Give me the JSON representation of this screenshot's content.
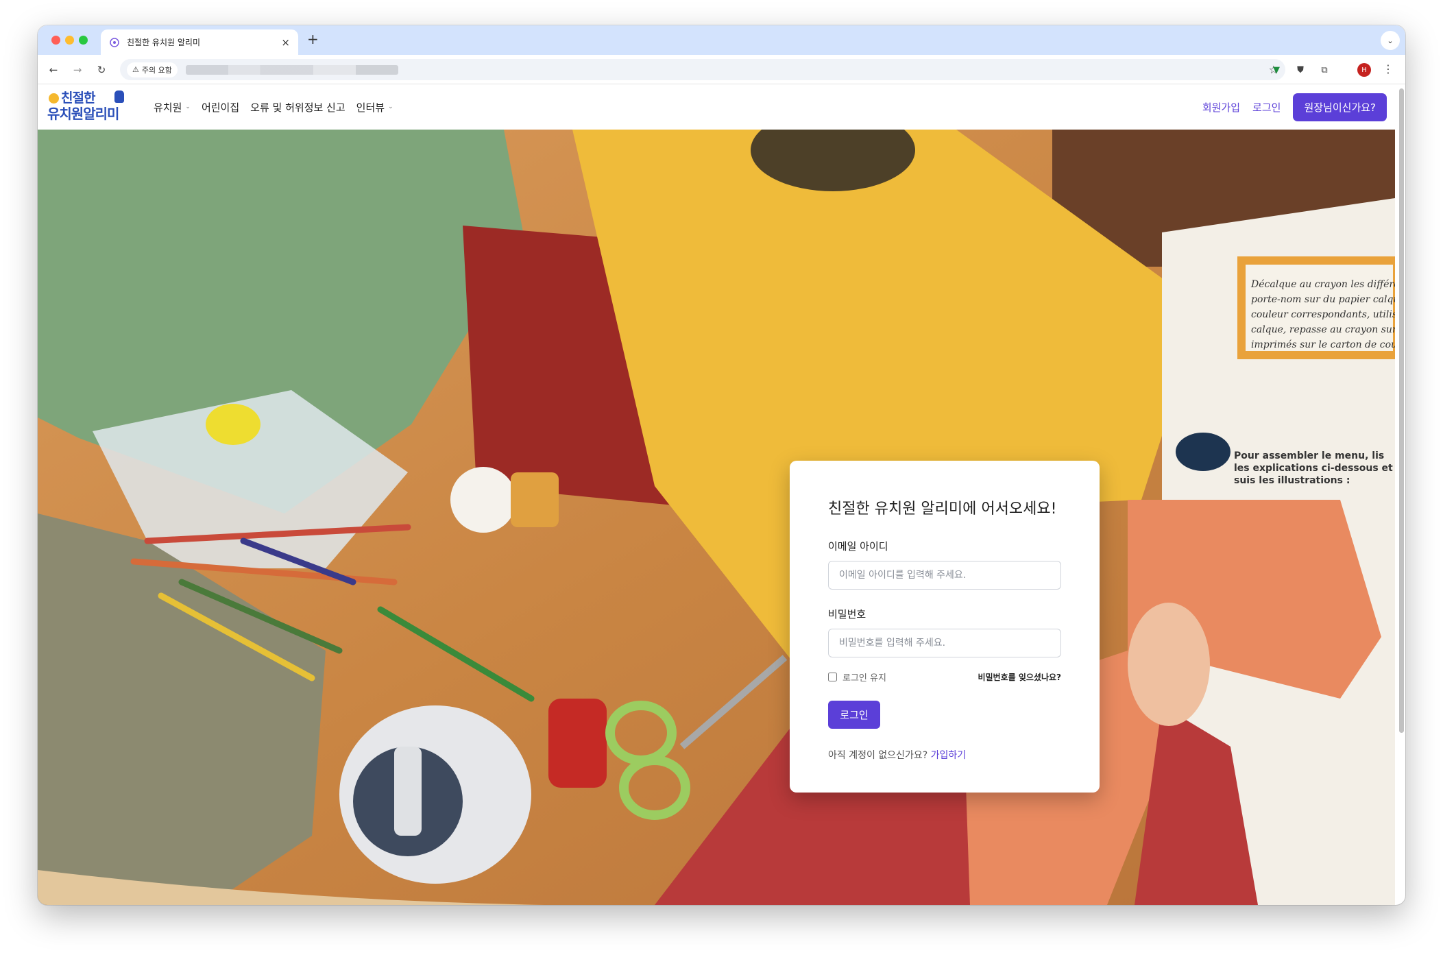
{
  "browser": {
    "tab_title": "친절한 유치원 알리미",
    "tab_close": "×",
    "new_tab": "+",
    "tab_search": "⌄",
    "security_label": "주의 요함",
    "avatar_initial": "H",
    "icons": [
      "back-icon",
      "forward-icon",
      "reload-icon",
      "warning-icon",
      "star-icon",
      "extension-vue-icon",
      "extension-shield-icon",
      "puzzle-icon",
      "kebab-menu-icon"
    ]
  },
  "header": {
    "logo_line1": "친절한",
    "logo_line2": "유치원알리미",
    "nav": [
      {
        "label": "유치원",
        "has_dropdown": true
      },
      {
        "label": "어린이집",
        "has_dropdown": false
      },
      {
        "label": "오류 및 허위정보 신고",
        "has_dropdown": false
      },
      {
        "label": "인터뷰",
        "has_dropdown": true
      }
    ],
    "signup": "회원가입",
    "login": "로그인",
    "director_button": "원장님이신가요?"
  },
  "login_card": {
    "title": "친절한 유치원 알리미에 어서오세요!",
    "email_label": "이메일 아이디",
    "email_placeholder": "이메일 아이디를 입력해 주세요.",
    "email_value": "",
    "password_label": "비밀번호",
    "password_placeholder": "비밀번호를 입력해 주세요.",
    "password_value": "",
    "remember_label": "로그인 유지",
    "remember_checked": false,
    "forgot_label": "비밀번호를 잊으셨나요?",
    "submit_label": "로그인",
    "no_account_text": "아직 계정이 없으신가요?",
    "signup_link": "가입하기"
  },
  "colors": {
    "accent": "#5b3fd8",
    "logo_blue": "#2a4fb9",
    "tabstrip": "#d3e3fd"
  }
}
